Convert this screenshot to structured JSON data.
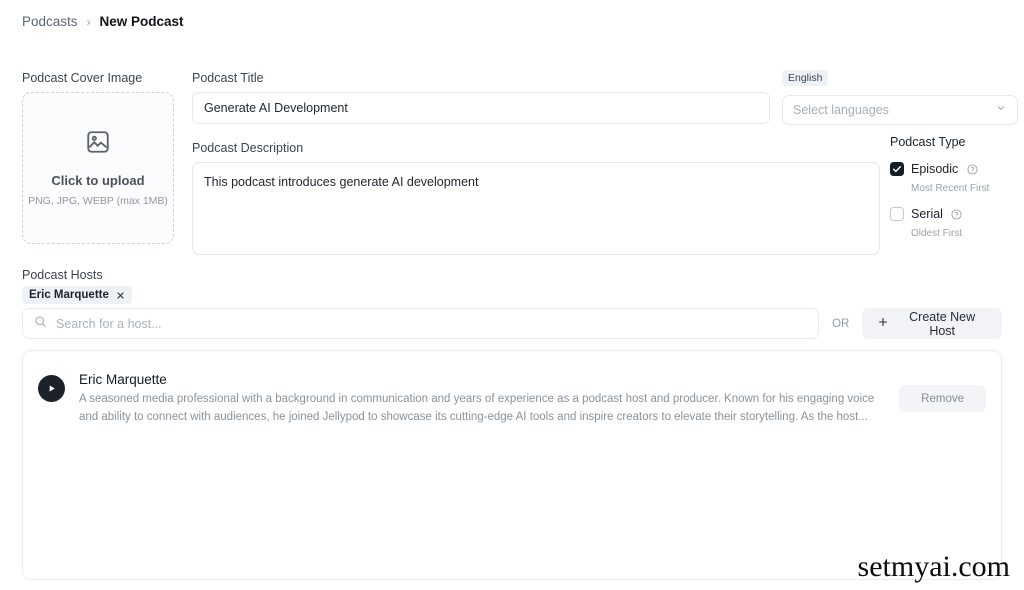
{
  "breadcrumb": {
    "root": "Podcasts",
    "separator": "›",
    "current": "New Podcast"
  },
  "cover": {
    "label": "Podcast Cover Image",
    "cta": "Click to upload",
    "hint": "PNG, JPG, WEBP (max 1MB)"
  },
  "title_field": {
    "label": "Podcast Title",
    "value": "Generate AI Development",
    "placeholder": "Podcast Title"
  },
  "description_field": {
    "label": "Podcast Description",
    "value": "This podcast introduces generate AI development",
    "placeholder": "Podcast Description"
  },
  "language": {
    "chip": "English",
    "placeholder": "Select languages"
  },
  "podcast_type": {
    "label": "Podcast Type",
    "options": [
      {
        "name": "Episodic",
        "sub": "Most Recent First",
        "checked": true
      },
      {
        "name": "Serial",
        "sub": "Oldest First",
        "checked": false
      }
    ]
  },
  "hosts": {
    "label": "Podcast Hosts",
    "selected_chip": "Eric Marquette",
    "search_placeholder": "Search for a host...",
    "or_label": "OR",
    "create_button": "Create New Host",
    "result": {
      "name": "Eric Marquette",
      "bio": "A seasoned media professional with a background in communication and years of experience as a podcast host and producer. Known for his engaging voice and ability to connect with audiences, he joined Jellypod to showcase its cutting-edge AI tools and inspire creators to elevate their storytelling. As the host...",
      "remove_label": "Remove"
    }
  },
  "watermark": "setmyai.com",
  "colors": {
    "accent_dark": "#161c28",
    "chip_bg": "#eef1f6",
    "border": "#e4e7ec",
    "muted_text": "#8b919c"
  }
}
